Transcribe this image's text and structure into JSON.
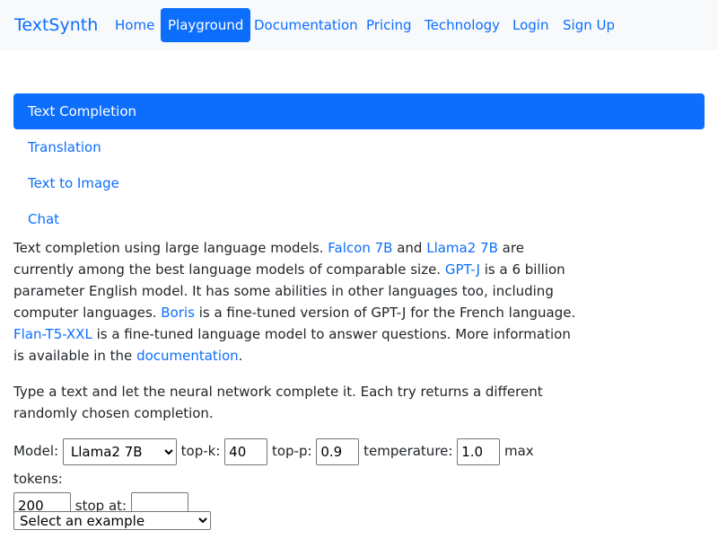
{
  "nav": {
    "brand": "TextSynth",
    "links": [
      "Home",
      "Playground",
      "Documentation",
      "Pricing",
      "Technology",
      "Login",
      "Sign Up"
    ],
    "active": "Playground"
  },
  "tabs": [
    "Text Completion",
    "Translation",
    "Text to Image",
    "Chat"
  ],
  "active_tab": "Text Completion",
  "description": {
    "t1": "Text completion using large language models. ",
    "l1": "Falcon 7B",
    "t2": " and ",
    "l2": "Llama2 7B",
    "t3": " are currently among the best language models of comparable size. ",
    "l3": "GPT-J",
    "t4": " is a 6 billion parameter English model. It has some abilities in other languages too, including computer languages. ",
    "l4": "Boris",
    "t5": " is a fine-tuned version of GPT-J for the French language. ",
    "l5": "Flan-T5-XXL",
    "t6": " is a fine-tuned language model to answer questions. More information is available in the ",
    "l6": "documentation",
    "t7": "."
  },
  "instructions": "Type a text and let the neural network complete it. Each try returns a different randomly chosen completion.",
  "params": {
    "model_label": "Model:",
    "model_value": "Llama2 7B",
    "topk_label": "top-k:",
    "topk_value": "40",
    "topp_label": "top-p:",
    "topp_value": "0.9",
    "temp_label": "temperature:",
    "temp_value": "1.0",
    "max_label": "max tokens:",
    "max_value": "200",
    "stop_label": "stop at:",
    "stop_value": ""
  },
  "example_select": "Select an example"
}
